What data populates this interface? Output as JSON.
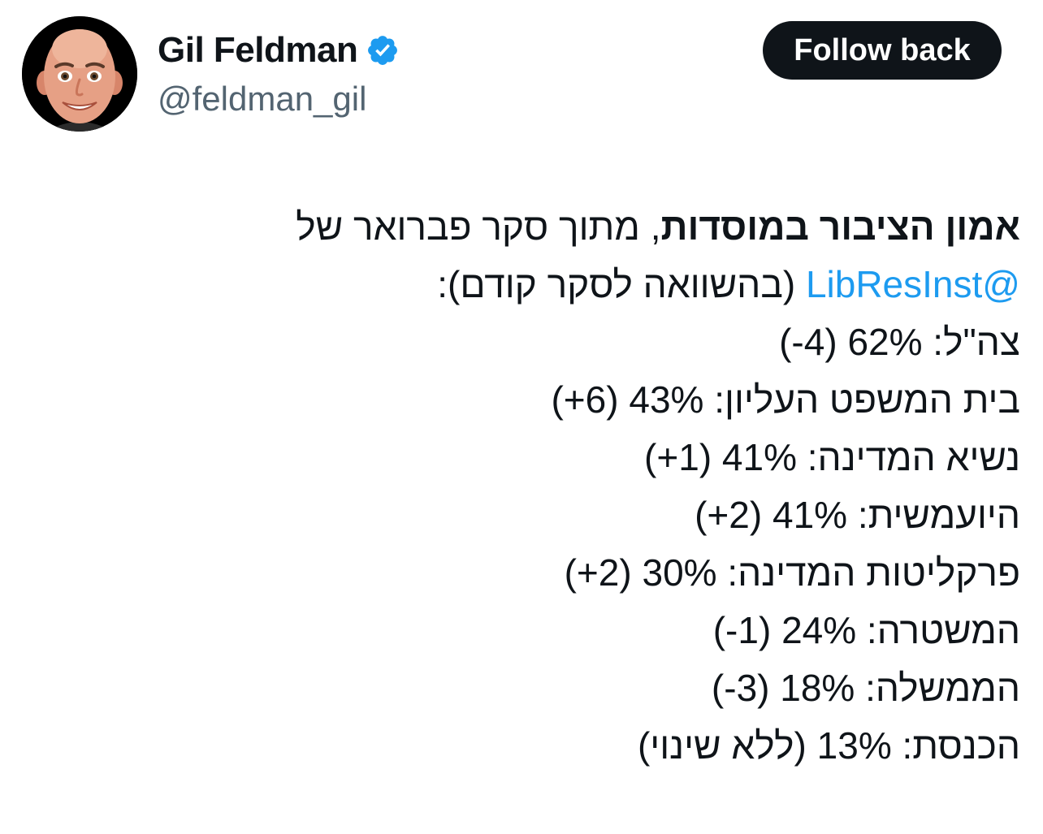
{
  "author": {
    "display_name": "Gil Feldman",
    "handle": "@feldman_gil",
    "verified": true,
    "avatar_icon": "memoji-avatar-icon",
    "verified_icon": "verified-badge-icon",
    "verified_color": "#1d9bf0"
  },
  "follow_button": {
    "label": "Follow back",
    "background": "#0f1419",
    "color": "#ffffff"
  },
  "tweet": {
    "intro_bold": "אמון הציבור במוסדות",
    "intro_rest": ", מתוך סקר פברואר של",
    "mention": "@LibResInst",
    "mention_color": "#1d9bf0",
    "mention_suffix": " (בהשוואה לסקר קודם):",
    "lines": [
      "צה\"ל: 62% (4-)",
      "בית המשפט העליון: 43% (6+)",
      "נשיא המדינה: 41% (1+)",
      "היועמשית: 41% (2+)",
      "פרקליטות המדינה: 30% (2+)",
      "המשטרה: 24% (1-)",
      "הממשלה: 18% (3-)",
      "הכנסת: 13% (ללא שינוי)"
    ]
  }
}
